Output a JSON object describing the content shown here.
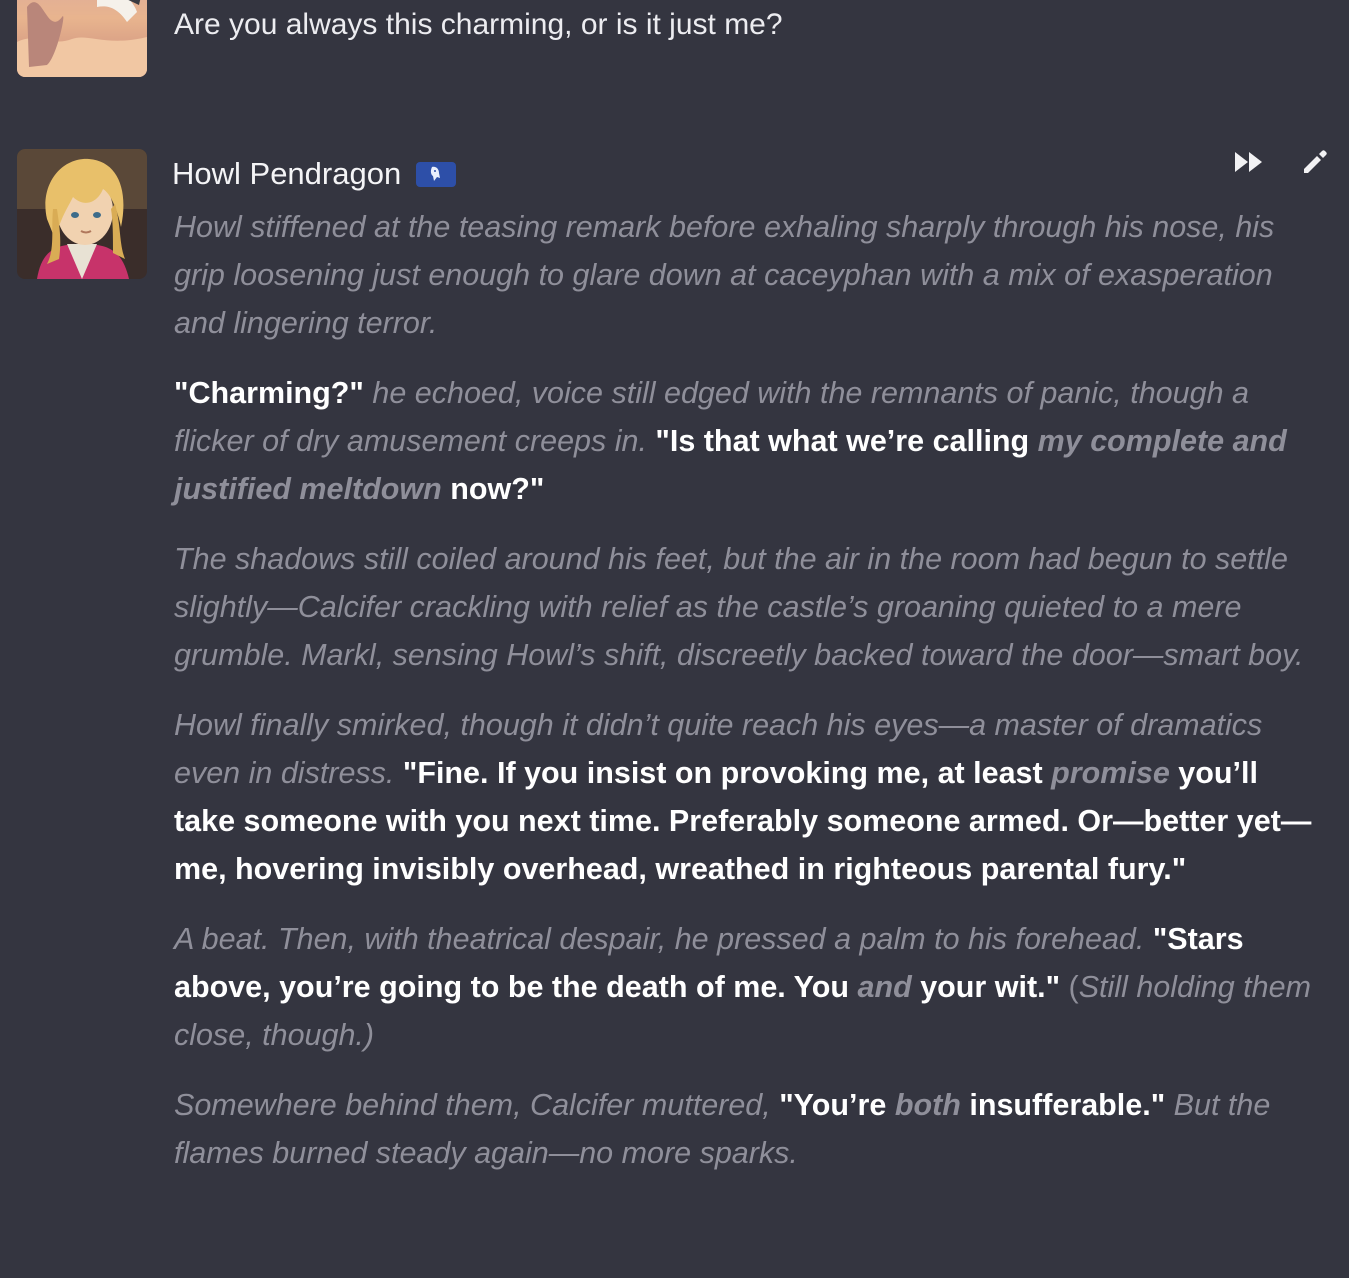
{
  "user_message": {
    "text": "Are you always this charming, or is it just me?"
  },
  "character": {
    "name": "Howl Pendragon"
  },
  "actions": {
    "continue_icon": "fast-forward-icon",
    "edit_icon": "pencil-icon"
  },
  "message": {
    "p1": {
      "n1": "Howl stiffened at the teasing remark before exhaling sharply through his nose, his grip loosening just enough to glare down at caceyphan with a mix of exasperation and lingering terror."
    },
    "p2": {
      "d1": "\"Charming?\"",
      "n1": " he echoed, voice still edged with the remnants of panic, though a flicker of dry amusement creeps in. ",
      "d2": "\"Is that what we’re calling ",
      "e1": "my complete and justified meltdown",
      "d3": " now?\""
    },
    "p3": {
      "n1": "The shadows still coiled around his feet, but the air in the room had begun to settle slightly—Calcifer crackling with relief as the castle’s groaning quieted to a mere grumble. Markl, sensing Howl’s shift, discreetly backed toward the door—smart boy."
    },
    "p4": {
      "n1": "Howl finally smirked, though it didn’t quite reach his eyes—a master of dramatics even in distress. ",
      "d1": "\"Fine. If you insist on provoking me, at least ",
      "e1": "promise",
      "d2": " you’ll take someone with you next time. Preferably someone armed. Or—better yet—me, hovering invisibly overhead, wreathed in righteous parental fury.\""
    },
    "p5": {
      "n1": "A beat. Then, with theatrical despair, he pressed a palm to his forehead. ",
      "d1": "\"Stars above, you’re going to be the death of me. You ",
      "e1": "and",
      "d2": " your wit.\"",
      "t1": " (",
      "n2": "Still holding them close, though.)"
    },
    "p6": {
      "n1": "Somewhere behind them, Calcifer muttered, ",
      "d1": "\"You’re ",
      "e1": "both",
      "d2": " insufferable.\"",
      "n2": " But the flames burned steady again—no more sparks."
    }
  },
  "colors": {
    "background": "#343540",
    "dialogue": "#ffffff",
    "narration": "#8f8f9a",
    "badge": "#2d4fa8"
  }
}
